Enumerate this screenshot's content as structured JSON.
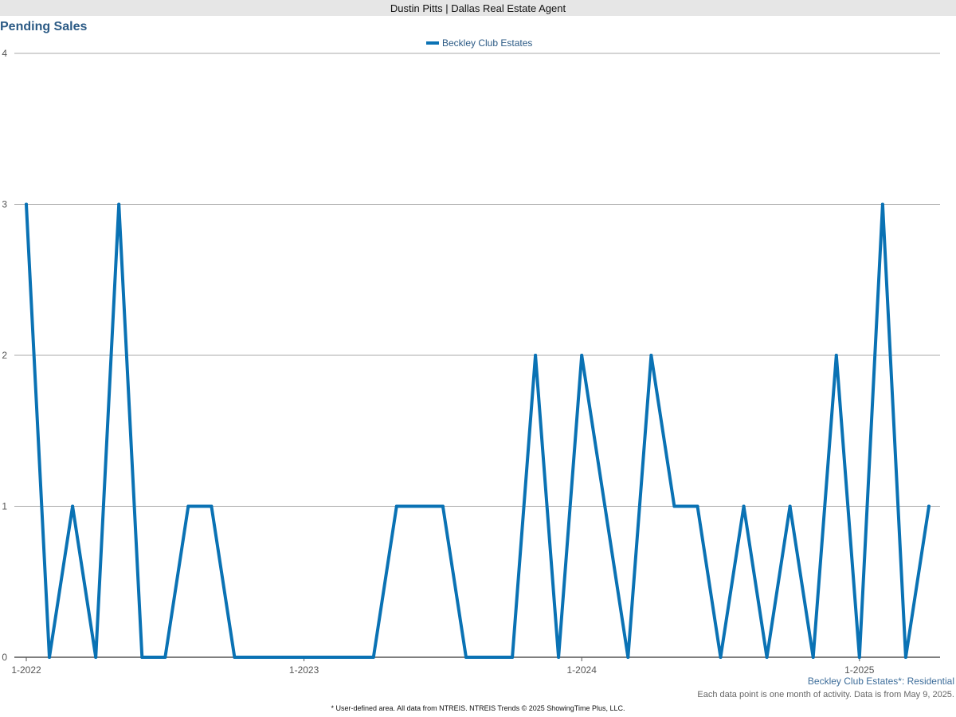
{
  "header": {
    "agent": "Dustin Pitts | Dallas Real Estate Agent"
  },
  "footer": {
    "area_label": "Beckley Club Estates*: Residential",
    "data_note": "Each data point is one month of activity. Data is from May 9, 2025.",
    "source_note": "* User-defined area. All data from NTREIS. NTREIS Trends © 2025 ShowingTime Plus, LLC."
  },
  "colors": {
    "series": "#0a72b4",
    "title": "#2b5a85",
    "grid": "#aaaaaa"
  },
  "chart_data": {
    "type": "line",
    "title": "Pending Sales",
    "xlabel": "",
    "ylabel": "",
    "ylim": [
      0,
      4
    ],
    "yticks": [
      0,
      1,
      2,
      3,
      4
    ],
    "x_start": "1-2022",
    "x_end": "4-2025",
    "x_ticks": [
      {
        "label": "1-2022",
        "month_index": 0
      },
      {
        "label": "1-2023",
        "month_index": 12
      },
      {
        "label": "1-2024",
        "month_index": 24
      },
      {
        "label": "1-2025",
        "month_index": 36
      }
    ],
    "legend_position": "top-center",
    "grid": true,
    "series": [
      {
        "name": "Beckley Club Estates",
        "values": [
          3,
          0,
          1,
          0,
          3,
          0,
          0,
          1,
          1,
          0,
          0,
          0,
          0,
          0,
          0,
          0,
          1,
          1,
          1,
          0,
          0,
          0,
          2,
          0,
          2,
          1,
          0,
          2,
          1,
          1,
          0,
          1,
          0,
          1,
          0,
          2,
          0,
          3,
          0,
          1
        ]
      }
    ]
  }
}
